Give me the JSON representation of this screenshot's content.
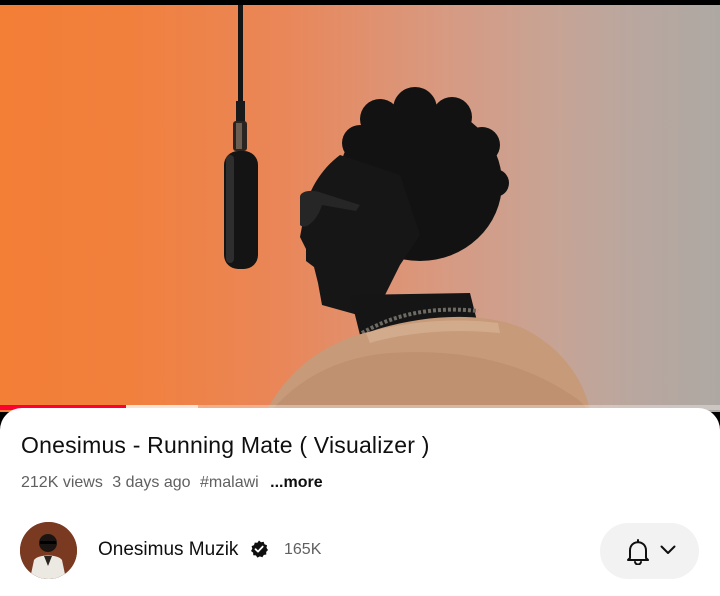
{
  "video": {
    "title": "Onesimus - Running Mate ( Visualizer )",
    "views": "212K views",
    "age": "3 days ago",
    "hashtag": "#malawi",
    "more_label": "...more",
    "progress": {
      "played_fraction": 0.175,
      "buffered_fraction": 0.275
    }
  },
  "channel": {
    "name": "Onesimus Muzik",
    "subscribers": "165K",
    "verified": true
  },
  "icons": {
    "verified": "verified-check-icon",
    "bell": "bell-icon",
    "dropdown": "chevron-down-icon"
  },
  "colors": {
    "progress_played": "#ff0033",
    "background_orange": "#f37e36",
    "background_gray": "#aea8a3",
    "subscribe_button_bg": "#f2f2f2"
  }
}
